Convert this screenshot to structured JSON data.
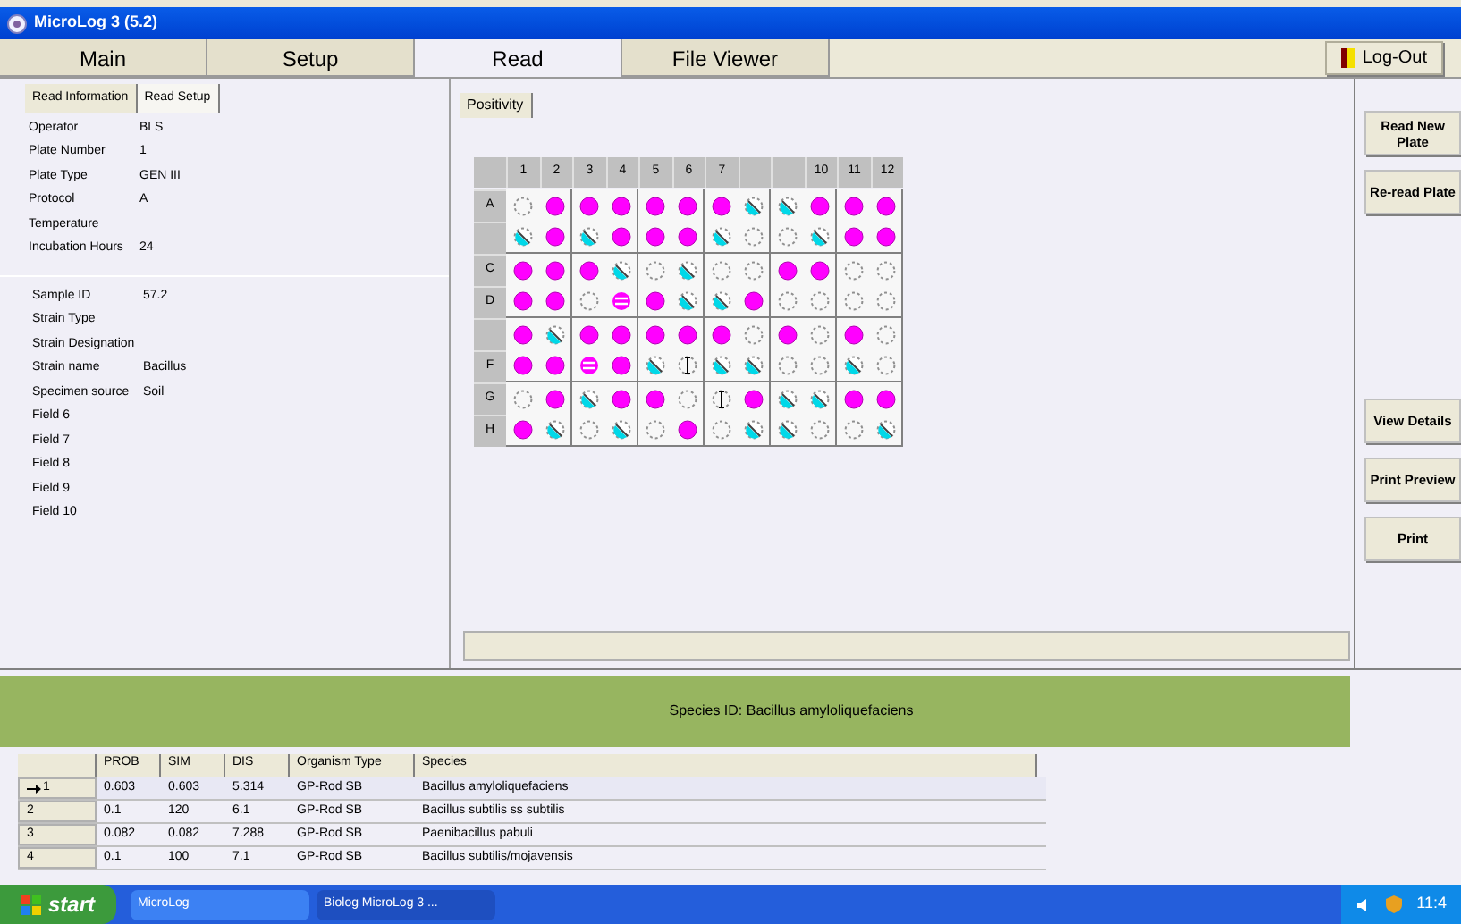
{
  "window": {
    "title": "MicroLog 3 (5.2)"
  },
  "tabs": [
    {
      "label": "Main",
      "selected": false
    },
    {
      "label": "Setup",
      "selected": false
    },
    {
      "label": "Read",
      "selected": true
    },
    {
      "label": "File Viewer",
      "selected": false
    }
  ],
  "logout": "Log-Out",
  "left_tabs": [
    {
      "label": "Read Information",
      "selected": true
    },
    {
      "label": "Read Setup",
      "selected": false
    }
  ],
  "plate_info": [
    {
      "label": "Operator",
      "value": "BLS"
    },
    {
      "label": "Plate Number",
      "value": "1"
    },
    {
      "label": "Plate Type",
      "value": "GEN III"
    },
    {
      "label": "Protocol",
      "value": "A"
    },
    {
      "label": "Temperature"
    },
    {
      "label": "Incubation Hours",
      "value": "24"
    }
  ],
  "sample_info": [
    {
      "label": "Sample ID",
      "value": "57.2"
    },
    {
      "label": "Strain Type"
    },
    {
      "label": "Strain Designation"
    },
    {
      "label": "Strain name",
      "value": "Bacillus"
    },
    {
      "label": "Specimen source",
      "value": "Soil"
    },
    {
      "label": "Field 6"
    },
    {
      "label": "Field 7"
    },
    {
      "label": "Field 8"
    },
    {
      "label": "Field 9"
    },
    {
      "label": "Field 10"
    }
  ],
  "plate_tab": "Positivity",
  "plate": {
    "columns": [
      "1",
      "2",
      "3",
      "4",
      "5",
      "6",
      "7",
      null,
      null,
      "10",
      "11",
      "12"
    ],
    "rows": [
      {
        "label": "A",
        "wells": [
          {
            "kind": "negative"
          },
          {
            "kind": "positive"
          },
          {
            "kind": "positive"
          },
          {
            "kind": "positive"
          },
          {
            "kind": "positive"
          },
          {
            "kind": "positive"
          },
          {
            "kind": "positive"
          },
          {
            "kind": "borderline"
          },
          {
            "kind": "borderline"
          },
          {
            "kind": "positive"
          },
          {
            "kind": "positive"
          },
          {
            "kind": "positive"
          }
        ]
      },
      {
        "wells": [
          {
            "kind": "borderline"
          },
          {
            "kind": "positive"
          },
          {
            "kind": "borderline"
          },
          {
            "kind": "positive"
          },
          {
            "kind": "positive"
          },
          {
            "kind": "positive"
          },
          {
            "kind": "borderline"
          },
          {
            "kind": "negative"
          },
          {
            "kind": "negative"
          },
          {
            "kind": "borderline"
          },
          {
            "kind": "positive"
          },
          {
            "kind": "positive"
          }
        ]
      },
      {
        "label": "C",
        "wells": [
          {
            "kind": "positive"
          },
          {
            "kind": "positive"
          },
          {
            "kind": "positive"
          },
          {
            "kind": "borderline"
          },
          {
            "kind": "negative"
          },
          {
            "kind": "borderline"
          },
          {
            "kind": "negative"
          },
          {
            "kind": "negative"
          },
          {
            "kind": "positive"
          },
          {
            "kind": "positive"
          },
          {
            "kind": "negative"
          },
          {
            "kind": "negative"
          }
        ]
      },
      {
        "label": "D",
        "wells": [
          {
            "kind": "positive"
          },
          {
            "kind": "positive"
          },
          {
            "kind": "negative"
          },
          {
            "kind": "equal"
          },
          {
            "kind": "positive"
          },
          {
            "kind": "borderline"
          },
          {
            "kind": "borderline"
          },
          {
            "kind": "positive"
          },
          {
            "kind": "negative"
          },
          {
            "kind": "negative"
          },
          {
            "kind": "negative"
          },
          {
            "kind": "negative"
          }
        ]
      },
      {
        "wells": [
          {
            "kind": "positive"
          },
          {
            "kind": "borderline"
          },
          {
            "kind": "positive"
          },
          {
            "kind": "positive"
          },
          {
            "kind": "positive"
          },
          {
            "kind": "positive"
          },
          {
            "kind": "positive"
          },
          {
            "kind": "negative"
          },
          {
            "kind": "positive"
          },
          {
            "kind": "negative"
          },
          {
            "kind": "positive"
          },
          {
            "kind": "negative"
          }
        ]
      },
      {
        "label": "F",
        "wells": [
          {
            "kind": "positive"
          },
          {
            "kind": "positive"
          },
          {
            "kind": "equal"
          },
          {
            "kind": "positive"
          },
          {
            "kind": "borderline"
          },
          {
            "kind": "ibeam"
          },
          {
            "kind": "borderline"
          },
          {
            "kind": "borderline"
          },
          {
            "kind": "negative"
          },
          {
            "kind": "negative"
          },
          {
            "kind": "borderline"
          },
          {
            "kind": "negative"
          }
        ]
      },
      {
        "label": "G",
        "wells": [
          {
            "kind": "negative"
          },
          {
            "kind": "positive"
          },
          {
            "kind": "borderline"
          },
          {
            "kind": "positive"
          },
          {
            "kind": "positive"
          },
          {
            "kind": "negative"
          },
          {
            "kind": "ibeam"
          },
          {
            "kind": "positive"
          },
          {
            "kind": "borderline"
          },
          {
            "kind": "borderline"
          },
          {
            "kind": "positive"
          },
          {
            "kind": "positive"
          }
        ]
      },
      {
        "label": "H",
        "wells": [
          {
            "kind": "positive"
          },
          {
            "kind": "borderline"
          },
          {
            "kind": "negative"
          },
          {
            "kind": "borderline"
          },
          {
            "kind": "negative"
          },
          {
            "kind": "positive"
          },
          {
            "kind": "negative"
          },
          {
            "kind": "borderline"
          },
          {
            "kind": "borderline"
          },
          {
            "kind": "negative"
          },
          {
            "kind": "negative"
          },
          {
            "kind": "borderline"
          }
        ]
      }
    ]
  },
  "buttons": [
    "Read New Plate",
    "Re-read Plate",
    "View Details",
    "Print Preview",
    "Print"
  ],
  "result": "Species ID: Bacillus amyloliquefaciens",
  "results_table": {
    "columns": [
      null,
      "PROB",
      "SIM",
      "DIS",
      "Organism Type",
      "Species"
    ],
    "rows": [
      {
        "selected": true,
        "cells": [
          "1",
          "0.603",
          "0.603",
          "5.314",
          "GP-Rod SB",
          "Bacillus amyloliquefaciens"
        ]
      },
      {
        "selected": false,
        "cells": [
          "2",
          "0.1",
          "120",
          "6.1",
          "GP-Rod SB",
          "Bacillus subtilis ss subtilis"
        ]
      },
      {
        "selected": false,
        "cells": [
          "3",
          "0.082",
          "0.082",
          "7.288",
          "GP-Rod SB",
          "Paenibacillus pabuli"
        ]
      },
      {
        "selected": false,
        "cells": [
          "4",
          "0.1",
          "100",
          "7.1",
          "GP-Rod SB",
          "Bacillus subtilis/mojavensis"
        ]
      }
    ]
  },
  "taskbar": {
    "start": "start",
    "items": [
      "MicroLog",
      "Biolog MicroLog 3 ..."
    ],
    "clock": "11:4"
  }
}
